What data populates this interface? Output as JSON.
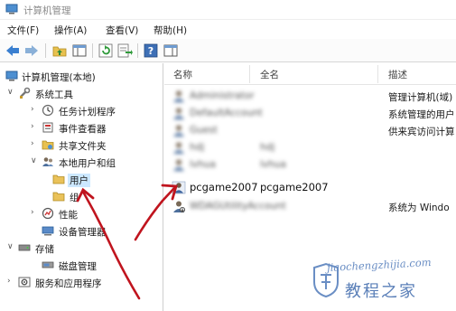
{
  "window": {
    "title": "计算机管理"
  },
  "menu": {
    "file": "文件(F)",
    "action": "操作(A)",
    "view": "查看(V)",
    "help": "帮助(H)"
  },
  "tree": {
    "items": [
      {
        "label": "计算机管理(本地)",
        "expander": ""
      },
      {
        "label": "系统工具",
        "expander": "∨"
      },
      {
        "label": "任务计划程序",
        "expander": "›"
      },
      {
        "label": "事件查看器",
        "expander": "›"
      },
      {
        "label": "共享文件夹",
        "expander": "›"
      },
      {
        "label": "本地用户和组",
        "expander": "∨"
      },
      {
        "label": "用户",
        "expander": ""
      },
      {
        "label": "组",
        "expander": ""
      },
      {
        "label": "性能",
        "expander": "›"
      },
      {
        "label": "设备管理器",
        "expander": ""
      },
      {
        "label": "存储",
        "expander": "∨"
      },
      {
        "label": "磁盘管理",
        "expander": ""
      },
      {
        "label": "服务和应用程序",
        "expander": "›"
      }
    ]
  },
  "list": {
    "columns": {
      "name": "名称",
      "fullname": "全名",
      "description": "描述"
    },
    "rows": [
      {
        "name": "Administrator",
        "fullname": "",
        "description": "管理计算机(域)"
      },
      {
        "name": "DefaultAccount",
        "fullname": "",
        "description": "系统管理的用户"
      },
      {
        "name": "Guest",
        "fullname": "",
        "description": "供来宾访问计算"
      },
      {
        "name": "hdj",
        "fullname": "hdj",
        "description": ""
      },
      {
        "name": "lvhua",
        "fullname": "lvhua",
        "description": ""
      },
      {
        "name": "pcgame2007",
        "fullname": "pcgame2007",
        "description": ""
      },
      {
        "name": "WDAGUtilityAccount",
        "fullname": "",
        "description": "系统为 Windo"
      }
    ]
  },
  "watermark": {
    "url": "jiaochengzhijia.com",
    "text": "教程之家"
  },
  "colors": {
    "arrow": "#c0141e",
    "selection": "#cce8ff"
  }
}
